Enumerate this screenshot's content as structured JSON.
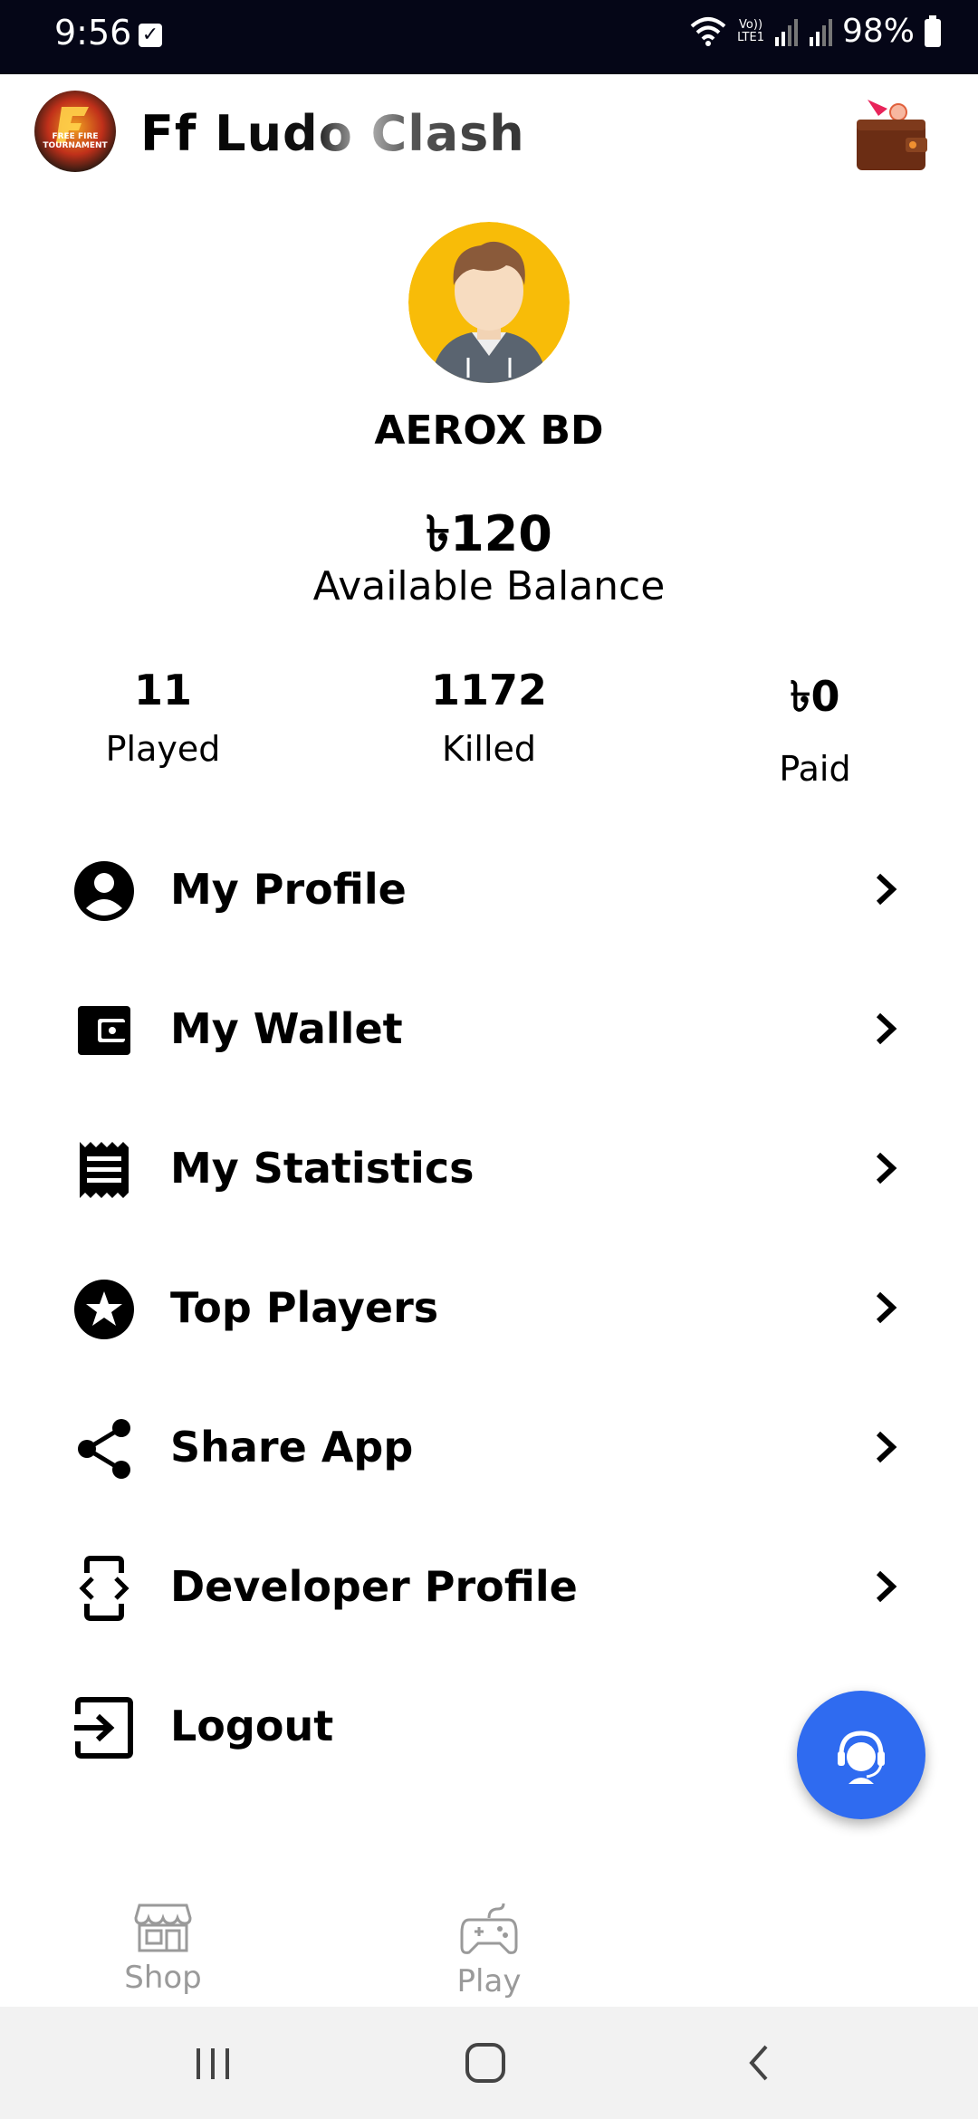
{
  "status_bar": {
    "time": "9:56",
    "battery": "98%",
    "network_label_top": "Vo))",
    "network_label_bottom": "LTE1"
  },
  "app_bar": {
    "title": "Ff Ludo Clash",
    "logo_text": "FREE FIRE TOURNAMENT"
  },
  "profile": {
    "name": "AEROX BD",
    "balance": "৳120",
    "balance_label": "Available Balance"
  },
  "stats": [
    {
      "value": "11",
      "label": "Played"
    },
    {
      "value": "1172",
      "label": "Killed"
    },
    {
      "value": "৳0",
      "label": "Paid"
    }
  ],
  "menu": [
    {
      "label": "My Profile",
      "icon": "account-circle-icon"
    },
    {
      "label": "My Wallet",
      "icon": "wallet-icon"
    },
    {
      "label": "My Statistics",
      "icon": "receipt-icon"
    },
    {
      "label": "Top Players",
      "icon": "star-circle-icon"
    },
    {
      "label": "Share App",
      "icon": "share-icon"
    },
    {
      "label": "Developer Profile",
      "icon": "developer-mode-icon"
    },
    {
      "label": "Logout",
      "icon": "logout-icon"
    }
  ],
  "bottom_nav": [
    {
      "label": "Shop",
      "icon": "store-icon"
    },
    {
      "label": "Play",
      "icon": "gamepad-icon"
    }
  ],
  "colors": {
    "status_bar_bg": "#050617",
    "fab": "#2f6bf0",
    "avatar_bg": "#f8bc08",
    "nav_inactive": "#9a9a9a"
  }
}
